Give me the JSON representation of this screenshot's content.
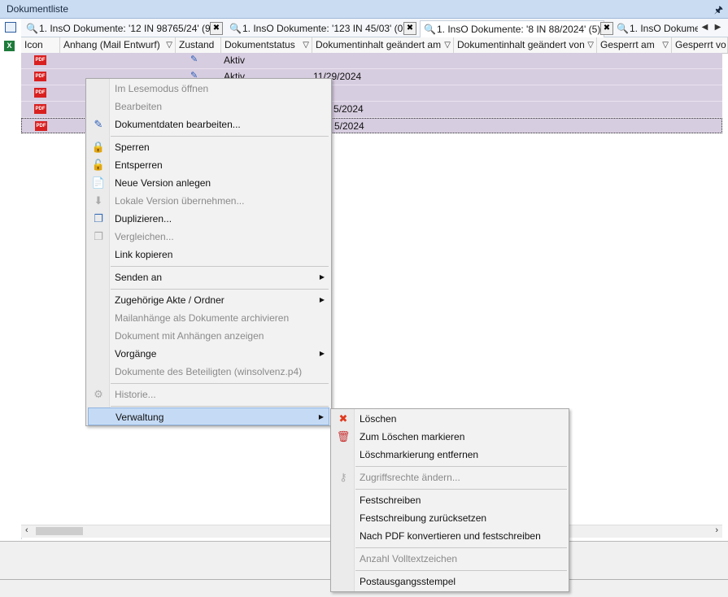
{
  "panel": {
    "title": "Dokumentliste",
    "pin_icon": "pin-icon"
  },
  "tabs": [
    {
      "label": "1. InsO Dokumente: '12 IN 98765/24' (9)",
      "active": false
    },
    {
      "label": "1. InsO Dokumente: '123 IN 45/03' (0)",
      "active": false
    },
    {
      "label": "1. InsO Dokumente: '8 IN 88/2024' (5)",
      "active": true
    },
    {
      "label": "1. InsO Dokume",
      "active": false
    }
  ],
  "columns": [
    "Icon",
    "Anhang (Mail Entwurf)",
    "Zustand",
    "Dokumentstatus",
    "Dokumentinhalt geändert am",
    "Dokumentinhalt geändert von",
    "Gesperrt am",
    "Gesperrt vo"
  ],
  "rows": [
    {
      "icon": "PDF",
      "status": "Aktiv",
      "changed": ""
    },
    {
      "icon": "PDF",
      "status": "Aktiv",
      "changed": "11/29/2024"
    },
    {
      "icon": "PDF",
      "status": "",
      "changed": ""
    },
    {
      "icon": "PDF",
      "status": "",
      "changed": "5/2024"
    },
    {
      "icon": "PDF",
      "status": "",
      "changed": "5/2024"
    }
  ],
  "context_menu": [
    {
      "label": "Im Lesemodus öffnen",
      "enabled": false
    },
    {
      "label": "Bearbeiten",
      "enabled": false
    },
    {
      "label": "Dokumentdaten bearbeiten...",
      "enabled": true,
      "icon": "pencil-icon"
    },
    {
      "label": "Sperren",
      "enabled": true,
      "icon": "lock-icon"
    },
    {
      "label": "Entsperren",
      "enabled": true,
      "icon": "unlock-icon"
    },
    {
      "label": "Neue Version anlegen",
      "enabled": true,
      "icon": "new-version-icon"
    },
    {
      "label": "Lokale Version übernehmen...",
      "enabled": false,
      "icon": "download-icon"
    },
    {
      "label": "Duplizieren...",
      "enabled": true,
      "icon": "duplicate-icon"
    },
    {
      "label": "Vergleichen...",
      "enabled": false,
      "icon": "compare-icon"
    },
    {
      "label": "Link kopieren",
      "enabled": true
    },
    {
      "label": "Senden an",
      "enabled": true,
      "submenu": true
    },
    {
      "label": "Zugehörige Akte / Ordner",
      "enabled": true,
      "submenu": true
    },
    {
      "label": "Mailanhänge als Dokumente archivieren",
      "enabled": false
    },
    {
      "label": "Dokument mit Anhängen anzeigen",
      "enabled": false
    },
    {
      "label": "Vorgänge",
      "enabled": true,
      "submenu": true
    },
    {
      "label": "Dokumente des Beteiligten (winsolvenz.p4)",
      "enabled": false
    },
    {
      "label": "Historie...",
      "enabled": false,
      "icon": "history-icon"
    },
    {
      "label": "Verwaltung",
      "enabled": true,
      "submenu": true,
      "highlighted": true
    }
  ],
  "submenu": [
    {
      "label": "Löschen",
      "enabled": true,
      "icon": "delete-x-icon"
    },
    {
      "label": "Zum Löschen markieren",
      "enabled": true,
      "icon": "mark-delete-icon"
    },
    {
      "label": "Löschmarkierung entfernen",
      "enabled": true
    },
    {
      "label": "Zugriffsrechte ändern...",
      "enabled": false,
      "icon": "key-icon"
    },
    {
      "label": "Festschreiben",
      "enabled": true
    },
    {
      "label": "Festschreibung zurücksetzen",
      "enabled": true
    },
    {
      "label": "Nach PDF konvertieren und festschreiben",
      "enabled": true
    },
    {
      "label": "Anzahl Volltextzeichen",
      "enabled": false
    },
    {
      "label": "Postausgangsstempel",
      "enabled": true
    }
  ],
  "colors": {
    "title_bg": "#c9dcf2",
    "row_bg": "#d7cde0",
    "highlight": "#c5dbf5",
    "pdf_red": "#d92020"
  }
}
